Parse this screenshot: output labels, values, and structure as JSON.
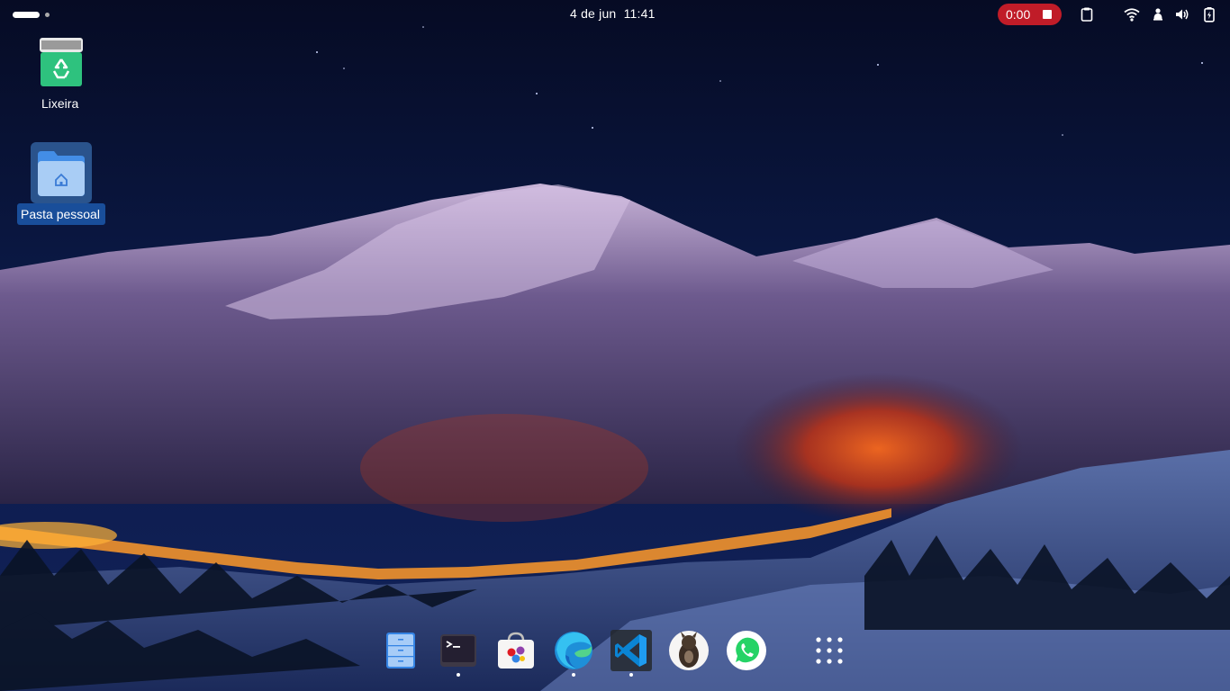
{
  "topbar": {
    "clock": "4 de jun  11:41",
    "recording": {
      "time": "0:00",
      "color": "#c01c28"
    },
    "tray_icons": [
      "clipboard-icon",
      "wifi-icon",
      "notification-bell-icon",
      "volume-icon",
      "battery-icon"
    ]
  },
  "desktop": {
    "icons": [
      {
        "label": "Lixeira",
        "icon": "trash-icon"
      },
      {
        "label": "Pasta pessoal",
        "icon": "home-folder-icon",
        "selected": true
      }
    ]
  },
  "dock": {
    "apps": [
      {
        "name": "files",
        "icon": "file-manager-icon",
        "running": false
      },
      {
        "name": "terminal",
        "icon": "terminal-icon",
        "running": true
      },
      {
        "name": "software",
        "icon": "software-store-icon",
        "running": false
      },
      {
        "name": "edge",
        "icon": "edge-browser-icon",
        "running": true
      },
      {
        "name": "vscode",
        "icon": "vscode-icon",
        "running": true
      },
      {
        "name": "app-avatar",
        "icon": "animal-avatar-icon",
        "running": false
      },
      {
        "name": "whatsapp",
        "icon": "whatsapp-icon",
        "running": false
      },
      {
        "name": "show-apps",
        "icon": "app-grid-icon",
        "running": false
      }
    ]
  }
}
